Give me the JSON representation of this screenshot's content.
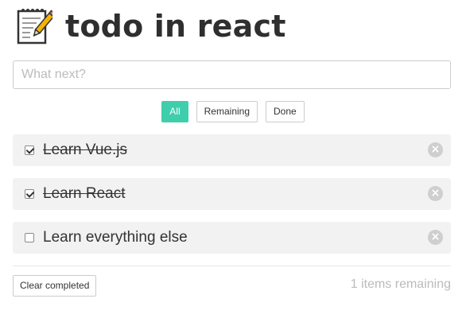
{
  "header": {
    "icon": "memo-icon",
    "title": "todo in react"
  },
  "input": {
    "placeholder": "What next?",
    "value": ""
  },
  "filters": [
    {
      "label": "All",
      "active": true
    },
    {
      "label": "Remaining",
      "active": false
    },
    {
      "label": "Done",
      "active": false
    }
  ],
  "todos": [
    {
      "text": "Learn Vue.js",
      "done": true
    },
    {
      "text": "Learn React",
      "done": true
    },
    {
      "text": "Learn everything else",
      "done": false
    }
  ],
  "footer": {
    "clear_label": "Clear completed",
    "remaining_count": "1",
    "remaining_suffix": "items remaining"
  },
  "colors": {
    "accent": "#3fceac",
    "item_bg": "#f2f2f2",
    "muted_text": "#bbbbbb"
  }
}
